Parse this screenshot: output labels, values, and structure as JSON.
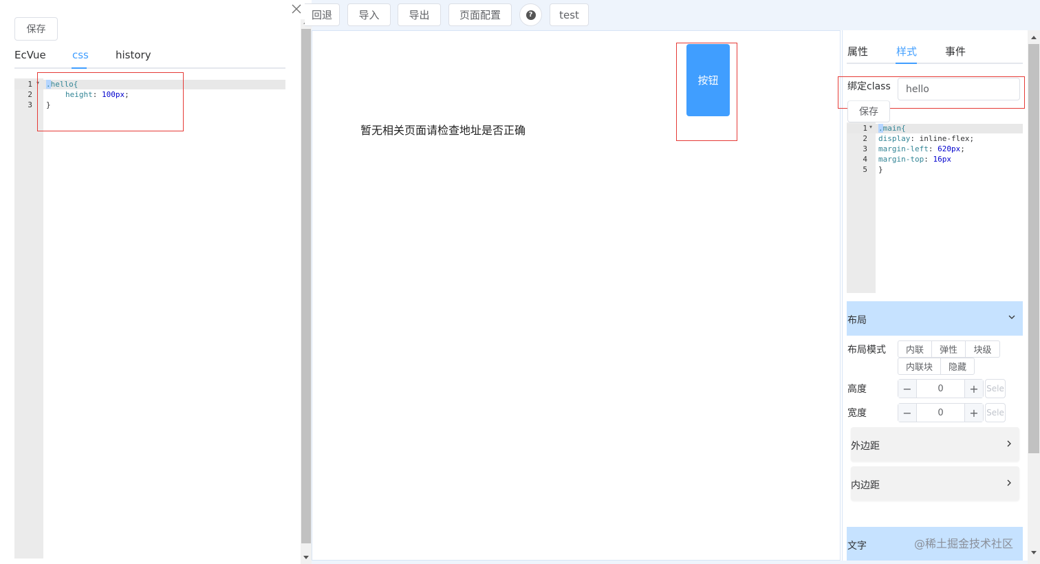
{
  "drawer": {
    "close_icon": "close-icon",
    "save_label": "保存",
    "tabs": [
      {
        "label": "EcVue",
        "active": false
      },
      {
        "label": "css",
        "active": true
      },
      {
        "label": "history",
        "active": false
      }
    ],
    "editor": {
      "line_numbers": [
        "1",
        "2",
        "3"
      ],
      "lines": {
        "l1_dot": ".",
        "l1_rest": "hello{",
        "l2_prop": "height",
        "l2_colon": ": ",
        "l2_val": "100px",
        "l2_semi": ";",
        "l3": "}"
      }
    }
  },
  "toolbar": {
    "back_label": "回退",
    "import_label": "导入",
    "export_label": "导出",
    "page_config_label": "页面配置",
    "help_icon": "question-icon",
    "test_label": "test"
  },
  "canvas": {
    "button_label": "按钮",
    "empty_message": "暂无相关页面请检查地址是否正确"
  },
  "right_panel": {
    "tabs": [
      {
        "label": "属性",
        "active": false
      },
      {
        "label": "样式",
        "active": true
      },
      {
        "label": "事件",
        "active": false
      }
    ],
    "bind_class_label": "绑定class",
    "bind_class_value": "hello",
    "save_label": "保存",
    "editor": {
      "line_numbers": [
        "1",
        "2",
        "3",
        "4",
        "5"
      ],
      "l1_dot": ".",
      "l1_rest": "main{",
      "l2_prop": "display",
      "l2_val": ": inline-flex;",
      "l3_prop": "margin-left",
      "l3_colon": ": ",
      "l3_val": "620px",
      "l3_semi": ";",
      "l4_prop": "margin-top",
      "l4_colon": ": ",
      "l4_val": "16px",
      "l5": "}"
    },
    "layout_section": {
      "title": "布局",
      "mode_label": "布局模式",
      "modes": [
        "内联",
        "弹性",
        "块级",
        "内联块",
        "隐藏"
      ],
      "height_label": "高度",
      "height_value": "0",
      "width_label": "宽度",
      "width_value": "0",
      "select_placeholder": "Sele",
      "margin_label": "外边距",
      "padding_label": "内边距"
    },
    "text_section": {
      "title": "文字"
    },
    "watermark": "@稀土掘金技术社区"
  },
  "colors": {
    "accent": "#409eff",
    "highlight_box": "#e53935",
    "section_bg": "#c6e2ff"
  }
}
